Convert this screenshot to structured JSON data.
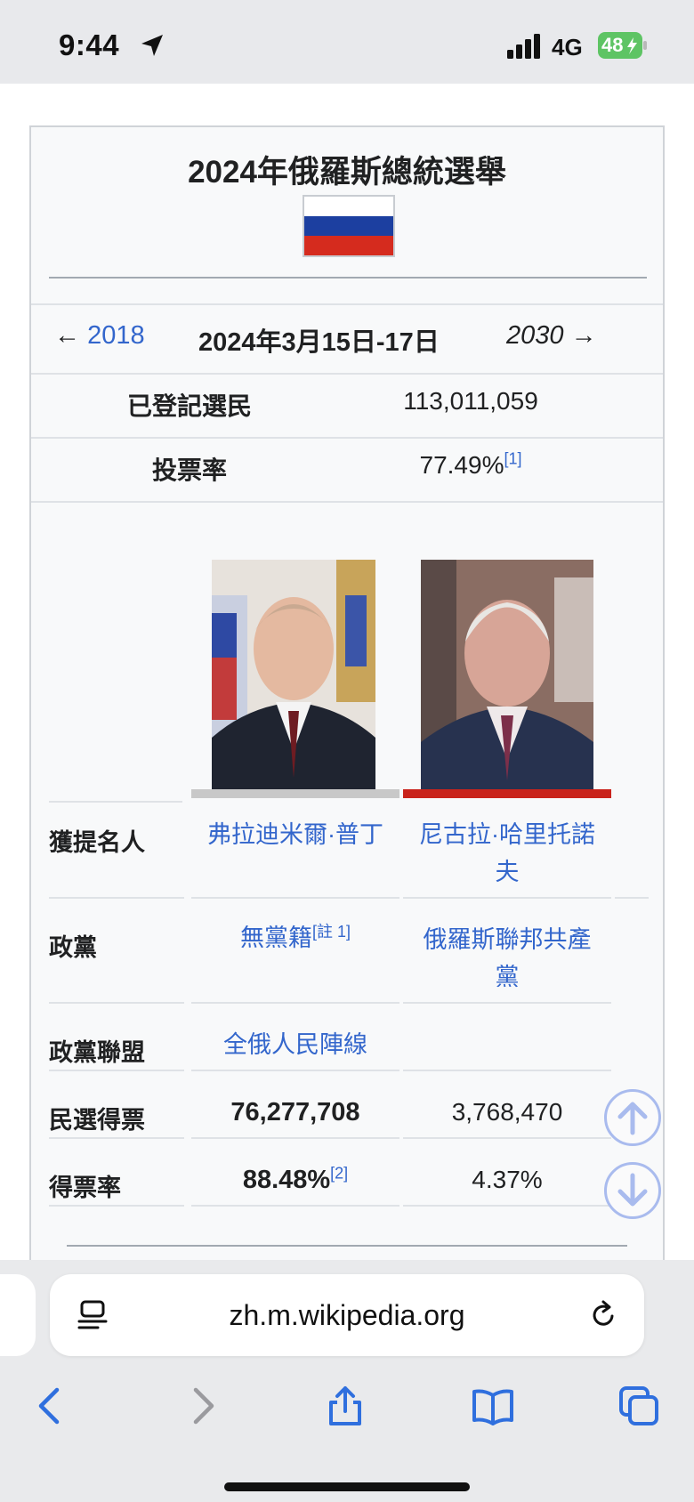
{
  "status": {
    "time": "9:44",
    "network": "4G",
    "battery": "48"
  },
  "infobox": {
    "title": "2024年俄羅斯總統選舉",
    "nav": {
      "prev_year": "2018",
      "date": "2024年3月15日-17日",
      "next_year": "2030"
    },
    "registered_voters": {
      "label": "已登記選民",
      "value": "113,011,059"
    },
    "turnout": {
      "label": "投票率",
      "value": "77.49%",
      "ref": "[1]"
    },
    "rows": {
      "nominee": {
        "label": "獲提名人",
        "c1": "弗拉迪米爾·普丁",
        "c2": "尼古拉·哈里托諾夫"
      },
      "party": {
        "label": "政黨",
        "c1": "無黨籍",
        "c1_ref": "[註 1]",
        "c2": "俄羅斯聯邦共產黨"
      },
      "alliance": {
        "label": "政黨聯盟",
        "c1": "全俄人民陣線"
      },
      "popular_vote": {
        "label": "民選得票",
        "c1": "76,277,708",
        "c2": "3,768,470"
      },
      "percentage": {
        "label": "得票率",
        "c1": "88.48%",
        "c1_ref": "[2]",
        "c2": "4.37%"
      }
    }
  },
  "browser": {
    "url": "zh.m.wikipedia.org"
  },
  "colors": {
    "link": "#3366cc",
    "putin_bar": "#c8c8c8",
    "kprf_bar": "#c9231b",
    "battery_green": "#5ec464"
  }
}
